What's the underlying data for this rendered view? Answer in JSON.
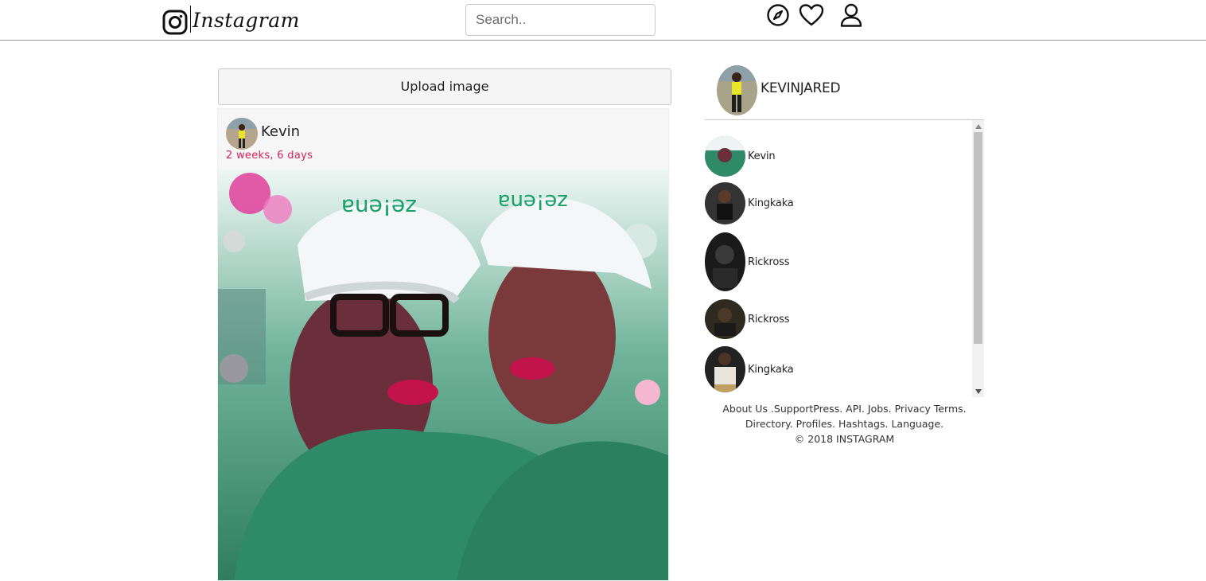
{
  "nav": {
    "brand": "Instagram",
    "search_placeholder": "Search..",
    "icons": [
      "instagram-logo-icon",
      "compass-icon",
      "heart-icon",
      "user-icon"
    ]
  },
  "feed": {
    "upload_label": "Upload image",
    "post": {
      "author": "Kevin",
      "time": "2 weeks, 6 days"
    }
  },
  "sidebar": {
    "profile_name": "KEVINJARED",
    "followers": [
      {
        "name": "Kevin"
      },
      {
        "name": "Kingkaka"
      },
      {
        "name": "Rickross"
      },
      {
        "name": "Rickross"
      },
      {
        "name": "Kingkaka"
      }
    ],
    "footer": {
      "line1": "About Us .SupportPress. API. Jobs. Privacy Terms.",
      "line2": "Directory. Profiles. Hashtags. Language.",
      "line3": "© 2018 INSTAGRAM"
    }
  },
  "colors": {
    "timestamp": "#d6205a",
    "nav_border": "#9a9a9a",
    "upload_bg": "#f5f5f5"
  }
}
